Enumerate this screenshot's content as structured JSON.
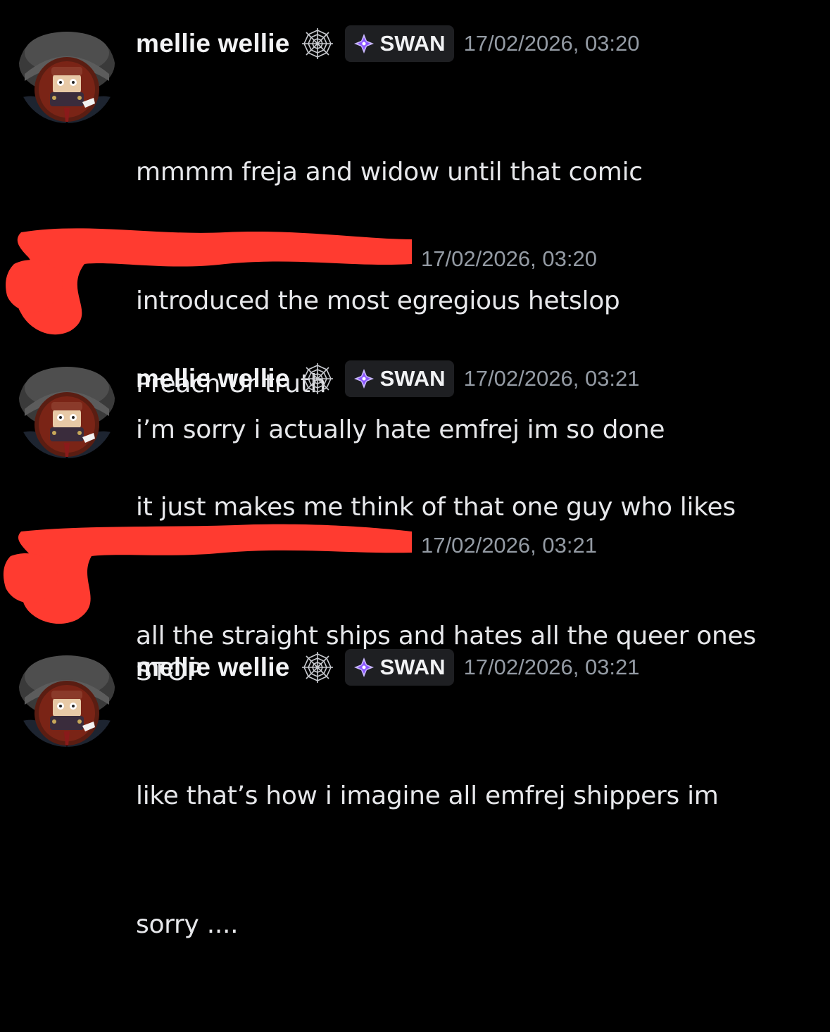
{
  "messages": [
    {
      "author": "mellie wellie",
      "author_icon": "spiderweb-icon",
      "tag": {
        "icon": "sparkle-icon",
        "label": "SWAN"
      },
      "timestamp": "17/02/2026, 03:20",
      "lines": [
        "mmmm freja and widow until that comic",
        "introduced the most egregious hetslop",
        "i’m sorry i actually hate emfrej im so done"
      ]
    },
    {
      "author": "",
      "author_redacted": true,
      "timestamp": "17/02/2026, 03:20",
      "lines": [
        "Preach Ur truth"
      ]
    },
    {
      "author": "mellie wellie",
      "author_icon": "spiderweb-icon",
      "tag": {
        "icon": "sparkle-icon",
        "label": "SWAN"
      },
      "timestamp": "17/02/2026, 03:21",
      "lines": [
        "it just makes me think of that one guy who likes",
        "all the straight ships and hates all the queer ones"
      ]
    },
    {
      "author": "",
      "author_redacted": true,
      "timestamp": "17/02/2026, 03:21",
      "lines": [
        "STOP"
      ]
    },
    {
      "author": "mellie wellie",
      "author_icon": "spiderweb-icon",
      "tag": {
        "icon": "sparkle-icon",
        "label": "SWAN"
      },
      "timestamp": "17/02/2026, 03:21",
      "lines": [
        "like that’s how i imagine all emfrej shippers im",
        "sorry ...."
      ]
    }
  ],
  "colors": {
    "background": "#000000",
    "redaction": "#ff3b30",
    "tag_background": "#1e1f22",
    "timestamp": "#949ba4",
    "sparkle": "#a970ff"
  }
}
